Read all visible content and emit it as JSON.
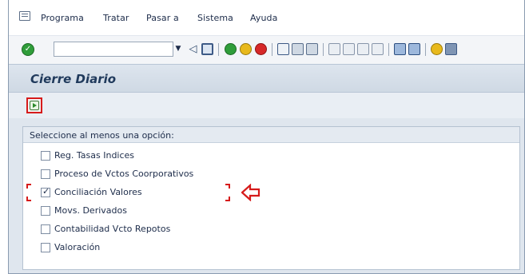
{
  "menubar": {
    "items": [
      {
        "label": "Programa"
      },
      {
        "label": "Tratar"
      },
      {
        "label": "Pasar a"
      },
      {
        "label": "Sistema"
      },
      {
        "label": "Ayuda"
      }
    ]
  },
  "toolbar": {
    "command_field_value": ""
  },
  "screen": {
    "title": "Cierre Diario"
  },
  "selection": {
    "header": "Seleccione al menos una opción:",
    "options": [
      {
        "label": "Reg. Tasas Indices",
        "checked": false
      },
      {
        "label": "Proceso de Vctos Coorporativos",
        "checked": false
      },
      {
        "label": "Conciliación Valores",
        "checked": true
      },
      {
        "label": "Movs. Derivados",
        "checked": false
      },
      {
        "label": "Contabilidad Vcto Repotos",
        "checked": false
      },
      {
        "label": "Valoración",
        "checked": false
      }
    ]
  },
  "colors": {
    "highlight": "#d61b1b",
    "title_text": "#203a5c"
  }
}
